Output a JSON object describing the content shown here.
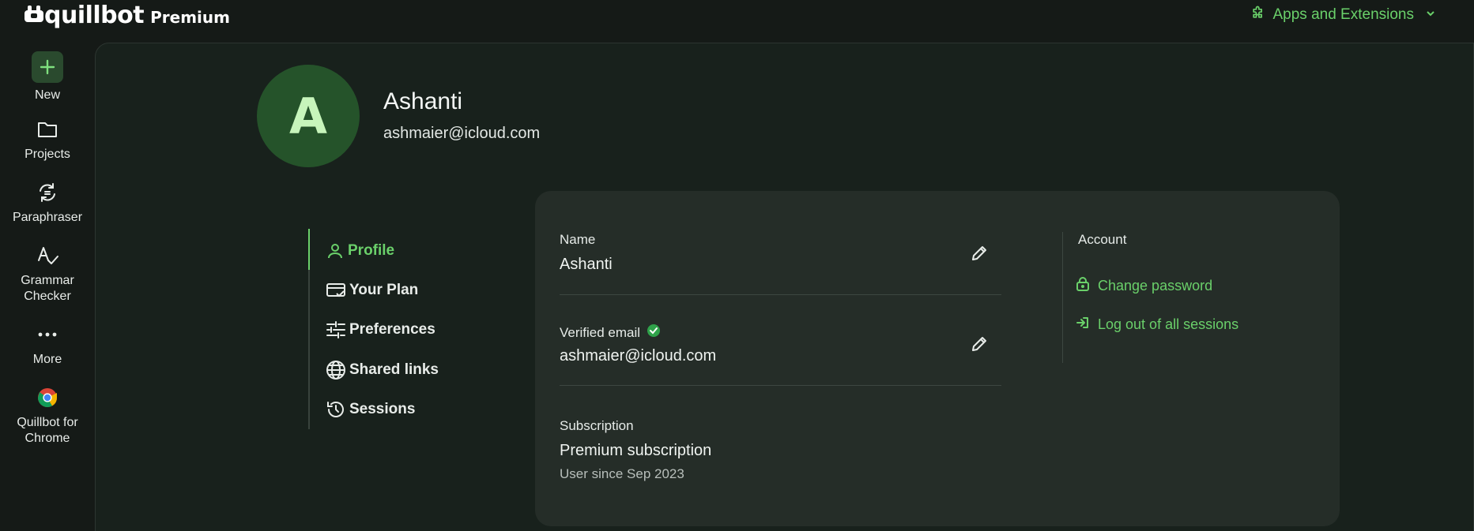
{
  "header": {
    "logo_text": "quillbot",
    "logo_badge": "Premium",
    "apps_extensions_label": "Apps and Extensions"
  },
  "leftnav": {
    "items": [
      {
        "label": "New",
        "icon": "plus-icon"
      },
      {
        "label": "Projects",
        "icon": "folder-icon"
      },
      {
        "label": "Paraphraser",
        "icon": "paraphraser-icon"
      },
      {
        "label": "Grammar Checker",
        "icon": "grammar-icon"
      },
      {
        "label": "More",
        "icon": "more-dots-icon"
      },
      {
        "label": "Quillbot for Chrome",
        "icon": "chrome-icon"
      }
    ]
  },
  "profile": {
    "avatar_letter": "A",
    "name": "Ashanti",
    "email": "ashmaier@icloud.com"
  },
  "tabs": [
    {
      "label": "Profile",
      "icon": "person-icon",
      "active": true
    },
    {
      "label": "Your Plan",
      "icon": "card-check-icon",
      "active": false
    },
    {
      "label": "Preferences",
      "icon": "sliders-icon",
      "active": false
    },
    {
      "label": "Shared links",
      "icon": "globe-icon",
      "active": false
    },
    {
      "label": "Sessions",
      "icon": "history-icon",
      "active": false
    }
  ],
  "card": {
    "name_label": "Name",
    "name_value": "Ashanti",
    "email_label": "Verified email",
    "email_value": "ashmaier@icloud.com",
    "subscription_label": "Subscription",
    "subscription_value": "Premium subscription",
    "subscription_since": "User since Sep 2023",
    "account_label": "Account",
    "change_password": "Change password",
    "logout_all": "Log out of all sessions"
  },
  "colors": {
    "accent": "#6ad06a",
    "background": "#151a17",
    "card": "#252d28",
    "avatar": "#25532a"
  }
}
